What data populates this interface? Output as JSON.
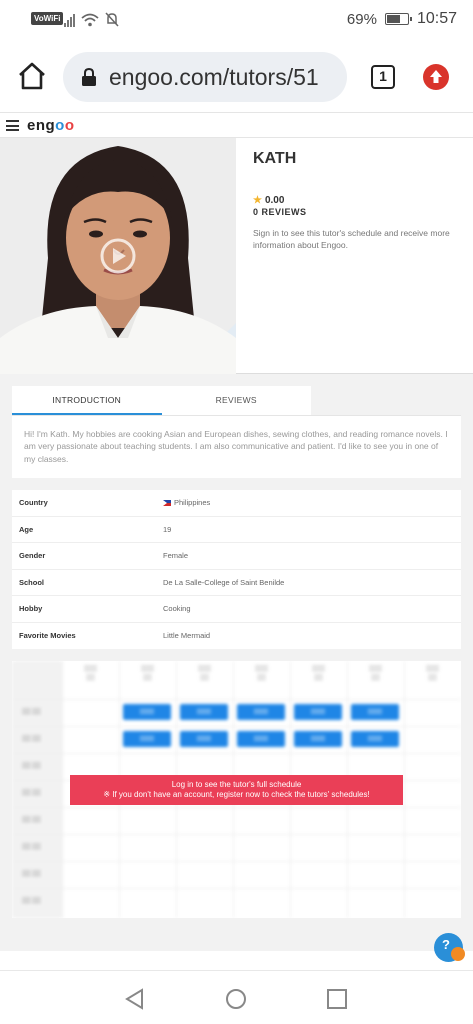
{
  "status_bar": {
    "wifi_tag": "VoWiFi",
    "battery": "69%",
    "battery_level": 0.69,
    "time": "10:57",
    "icons": [
      "signal-icon",
      "wifi-icon",
      "mute-icon",
      "battery-icon"
    ]
  },
  "browser": {
    "url": "engoo.com/tutors/51",
    "tab_count": "1",
    "icons": [
      "home-icon",
      "lock-icon",
      "update-icon"
    ]
  },
  "site": {
    "logo": {
      "g": "eng",
      "o1": "o",
      "o2": "o"
    }
  },
  "profile": {
    "name": "KATH",
    "rating": "0.00",
    "reviews": "0 REVIEWS",
    "signin_note": "Sign in to see this tutor's schedule and receive more information about Engoo."
  },
  "tabs": {
    "introduction": "INTRODUCTION",
    "reviews": "REVIEWS"
  },
  "intro_text": "Hi! I'm Kath. My hobbies are cooking Asian and European dishes, sewing clothes, and reading romance novels. I am very passionate about teaching students. I am also communicative and patient. I'd like to see you in one of my classes.",
  "info": [
    {
      "key": "Country",
      "value": "Philippines"
    },
    {
      "key": "Age",
      "value": "19"
    },
    {
      "key": "Gender",
      "value": "Female"
    },
    {
      "key": "School",
      "value": "De La Salle-College of Saint Benilde"
    },
    {
      "key": "Hobby",
      "value": "Cooking"
    },
    {
      "key": "Favorite Movies",
      "value": "Little Mermaid"
    }
  ],
  "schedule": {
    "login_title": "Log in to see the tutor's full schedule",
    "login_sub": "※ If you don't have an account, register now to check the tutors' schedules!",
    "colors": {
      "available": "#1f86e6",
      "banner": "#ea3f57"
    }
  }
}
